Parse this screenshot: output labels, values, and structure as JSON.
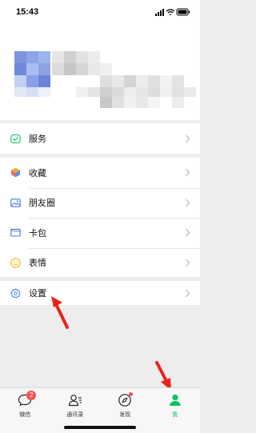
{
  "status_bar": {
    "time": "15:43",
    "icons": [
      "signal-icon",
      "wifi-icon",
      "battery-icon"
    ]
  },
  "menu": {
    "services": {
      "label": "服务",
      "icon": "services-icon"
    },
    "main_items": [
      {
        "label": "收藏",
        "icon": "favorites-icon"
      },
      {
        "label": "朋友圈",
        "icon": "moments-icon"
      },
      {
        "label": "卡包",
        "icon": "card-wallet-icon"
      },
      {
        "label": "表情",
        "icon": "stickers-icon"
      }
    ],
    "settings": {
      "label": "设置",
      "icon": "settings-icon"
    }
  },
  "tabbar": {
    "tabs": [
      {
        "label": "微信",
        "icon": "chats-icon",
        "badge": "2"
      },
      {
        "label": "通讯录",
        "icon": "contacts-icon"
      },
      {
        "label": "发现",
        "icon": "discover-icon"
      },
      {
        "label": "我",
        "icon": "me-icon",
        "active": true
      }
    ]
  },
  "colors": {
    "accent_green": "#07c160",
    "badge_red": "#fa5151",
    "annotation_red": "#e8231a",
    "background": "#ededed"
  }
}
